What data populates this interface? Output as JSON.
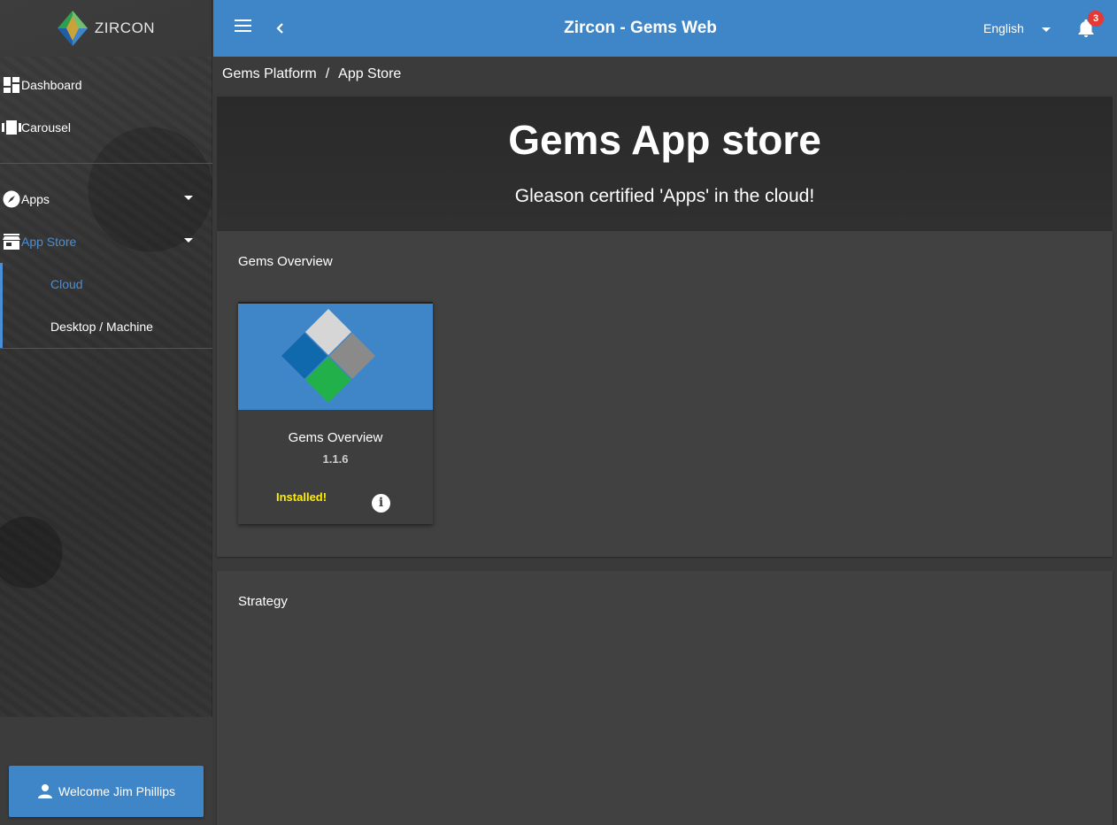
{
  "brand": {
    "name": "ZIRCON",
    "logo_icon": "zircon-diamond-logo"
  },
  "sidebar": {
    "items": [
      {
        "label": "Dashboard",
        "icon": "dashboard-icon"
      },
      {
        "label": "Carousel",
        "icon": "carousel-icon"
      },
      {
        "label": "Apps",
        "icon": "compass-icon",
        "expandable": true
      },
      {
        "label": "App Store",
        "icon": "store-icon",
        "expandable": true,
        "active": true
      }
    ],
    "app_store_children": [
      {
        "label": "Cloud",
        "selected": true
      },
      {
        "label": "Desktop / Machine",
        "selected": false
      }
    ],
    "welcome": "Welcome Jim Phillips"
  },
  "topbar": {
    "title": "Zircon - Gems Web",
    "language": "English",
    "notification_count": "3"
  },
  "breadcrumb": {
    "root": "Gems Platform",
    "separator": "/",
    "current": "App Store"
  },
  "hero": {
    "title": "Gems App store",
    "subtitle": "Gleason certified 'Apps' in the cloud!"
  },
  "sections": [
    {
      "title": "Gems Overview",
      "apps": [
        {
          "name": "Gems Overview",
          "version": "1.1.6",
          "status": "Installed!"
        }
      ]
    },
    {
      "title": "Strategy",
      "apps": []
    }
  ],
  "colors": {
    "primary": "#3f86c9",
    "active_text": "#4a8fd6",
    "installed": "#ffee00",
    "badge": "#e53935"
  }
}
